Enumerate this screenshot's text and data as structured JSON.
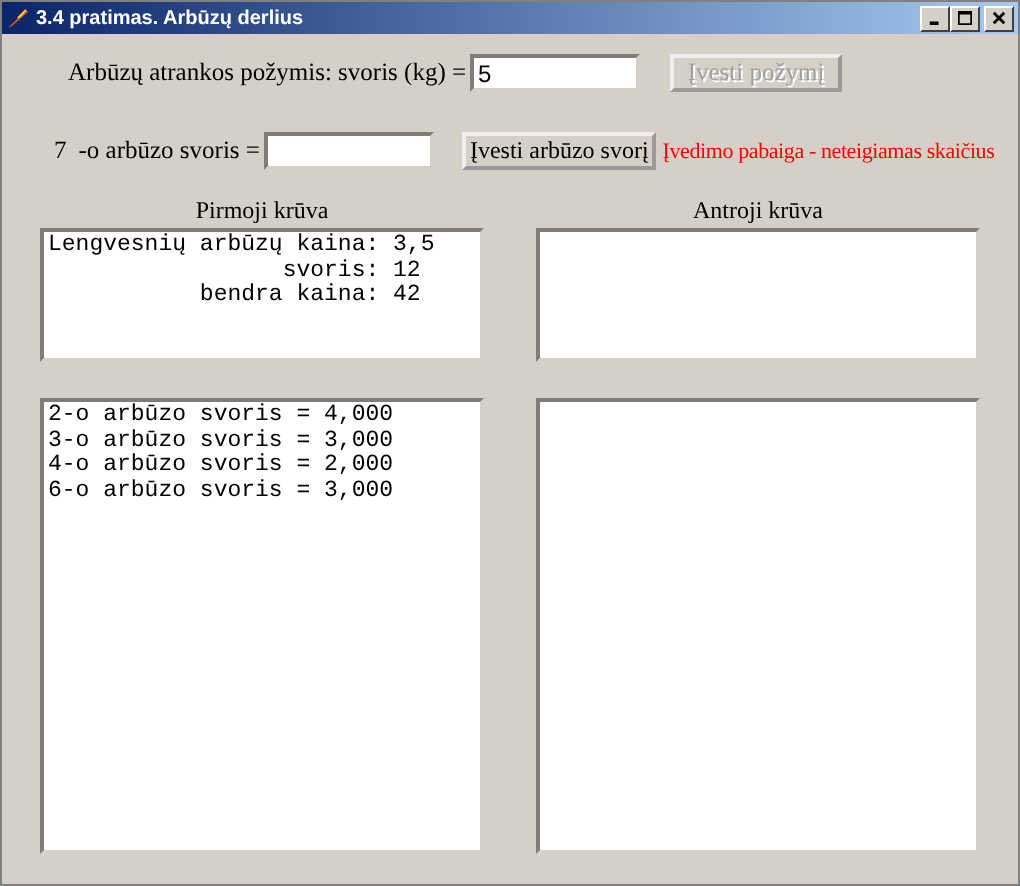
{
  "window": {
    "title": "3.4 pratimas. Arbūzų derlius"
  },
  "criterion": {
    "label": "Arbūzų atrankos požymis: svoris (kg) =",
    "value": "5",
    "button": {
      "label": "Įvesti požymį",
      "disabled": true
    }
  },
  "entry": {
    "index": "7",
    "label": "-o arbūzo svoris =",
    "button": {
      "label": "Įvesti arbūzo svorį",
      "disabled": false
    },
    "message": "Įvedimo pabaiga - neteigiamas skaičius"
  },
  "piles": [
    {
      "heading": "Pirmoji krūva",
      "summary": [
        "Lengvesnių arbūzų kaina: 3,5",
        "                 svoris: 12",
        "           bendra kaina: 42"
      ],
      "list": [
        "2-o arbūzo svoris = 4,000",
        "3-o arbūzo svoris = 3,000",
        "4-o arbūzo svoris = 2,000",
        "6-o arbūzo svoris = 3,000"
      ]
    },
    {
      "heading": "Antroji krūva"
    }
  ]
}
